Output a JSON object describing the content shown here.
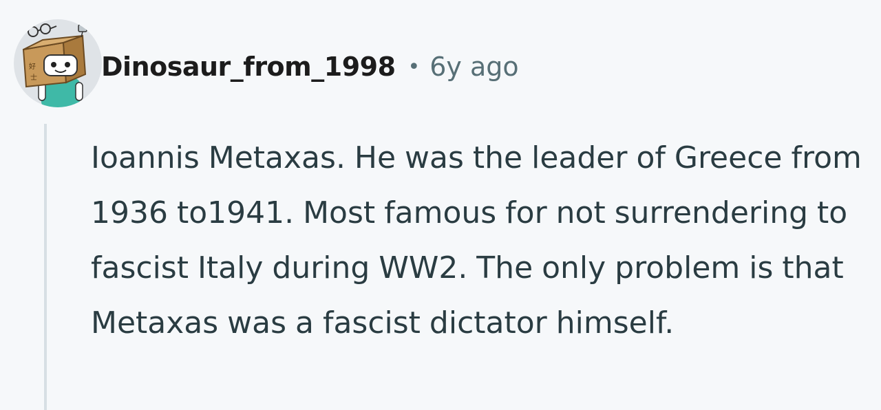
{
  "comment": {
    "author": "Dinosaur_from_1998",
    "separator": "•",
    "age": "6y ago",
    "body": "Ioannis Metaxas. He was the leader of Greece from 1936 to1941. Most famous for not surrendering to fascist Italy during WW2. The only problem is that Metaxas was a fascist dictator himself."
  },
  "colors": {
    "background": "#f6f8fa",
    "author": "#1c1c1c",
    "meta": "#576f76",
    "body": "#2a3c42",
    "thread_line": "#d7dfe4"
  },
  "icons": {
    "avatar": "snoo-cardboard-box-avatar"
  }
}
